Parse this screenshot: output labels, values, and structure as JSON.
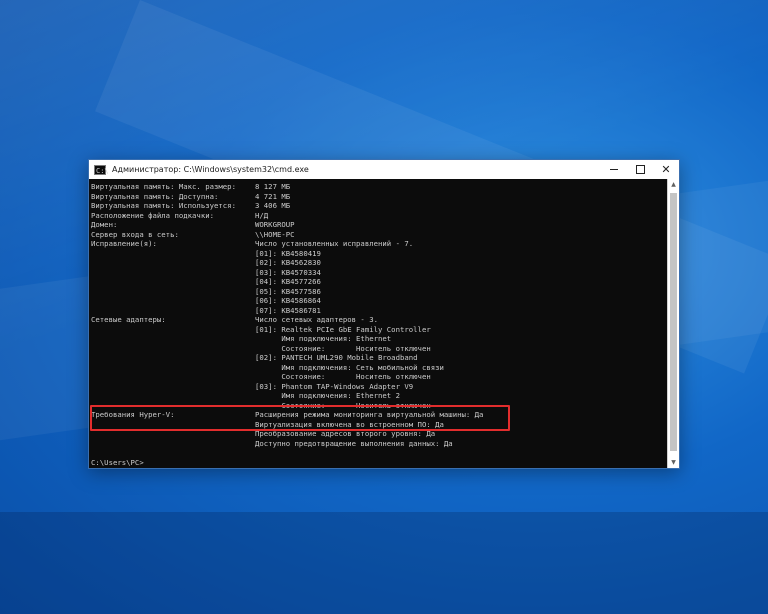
{
  "window": {
    "title": "Администратор: C:\\Windows\\system32\\cmd.exe",
    "app_icon_glyph": "C:\\",
    "controls": {
      "minimize": "–",
      "maximize": "□",
      "close": "✕"
    }
  },
  "console": {
    "lines": [
      {
        "label": "Виртуальная память: Макс. размер:",
        "value": "8 127 МБ"
      },
      {
        "label": "Виртуальная память: Доступна:",
        "value": "4 721 МБ"
      },
      {
        "label": "Виртуальная память: Используется:",
        "value": "3 406 МБ"
      },
      {
        "label": "Расположение файла подкачки:",
        "value": "Н/Д"
      },
      {
        "label": "Домен:",
        "value": "WORKGROUP"
      },
      {
        "label": "Сервер входа в сеть:",
        "value": "\\\\HOME-PC"
      },
      {
        "label": "Исправление(я):",
        "value": "Число установленных исправлений - 7."
      },
      {
        "label": "",
        "value": "[01]: KB4580419"
      },
      {
        "label": "",
        "value": "[02]: KB4562830"
      },
      {
        "label": "",
        "value": "[03]: KB4570334"
      },
      {
        "label": "",
        "value": "[04]: KB4577266"
      },
      {
        "label": "",
        "value": "[05]: KB4577586"
      },
      {
        "label": "",
        "value": "[06]: KB4586864"
      },
      {
        "label": "",
        "value": "[07]: KB4586781"
      },
      {
        "label": "Сетевые адаптеры:",
        "value": "Число сетевых адаптеров - 3."
      },
      {
        "label": "",
        "value": "[01]: Realtek PCIe GbE Family Controller"
      },
      {
        "label": "",
        "value": "      Имя подключения: Ethernet"
      },
      {
        "label": "",
        "value": "      Состояние:       Носитель отключен"
      },
      {
        "label": "",
        "value": "[02]: PANTECH UML290 Mobile Broadband"
      },
      {
        "label": "",
        "value": "      Имя подключения: Сеть мобильной связи"
      },
      {
        "label": "",
        "value": "      Состояние:       Носитель отключен"
      },
      {
        "label": "",
        "value": "[03]: Phantom TAP-Windows Adapter V9"
      },
      {
        "label": "",
        "value": "      Имя подключения: Ethernet 2"
      },
      {
        "label": "",
        "value": "      Состояние:       Носитель отключен"
      },
      {
        "label": "Требования Hyper-V:",
        "value": "Расширения режима мониторинга виртуальной машины: Да"
      },
      {
        "label": "",
        "value": "Виртуализация включена во встроенном ПО: Да"
      },
      {
        "label": "",
        "value": "Преобразование адресов второго уровня: Да"
      },
      {
        "label": "",
        "value": "Доступно предотвращение выполнения данных: Да"
      },
      {
        "label": "",
        "value": ""
      },
      {
        "label": "C:\\Users\\PC>",
        "value": ""
      }
    ]
  },
  "colors": {
    "console_bg": "#0c0c0c",
    "console_text": "#cccccc",
    "highlight_border": "#e22d2d",
    "desktop_blue": "#1167c7"
  }
}
